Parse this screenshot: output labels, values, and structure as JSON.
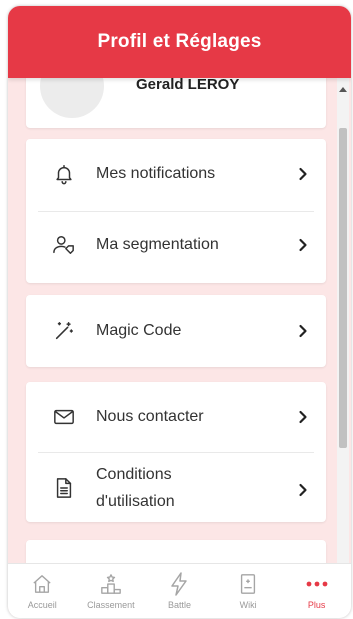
{
  "header": {
    "title": "Profil et Réglages"
  },
  "profile": {
    "name": "Gerald LEROY"
  },
  "menu": {
    "group1": [
      {
        "label": "Mes notifications",
        "icon": "bell-icon"
      },
      {
        "label": "Ma segmentation",
        "icon": "user-tag-icon"
      }
    ],
    "group2": [
      {
        "label": "Magic Code",
        "icon": "magic-wand-icon"
      }
    ],
    "group3": [
      {
        "label": "Nous contacter",
        "icon": "envelope-icon"
      },
      {
        "label_line1": "Conditions",
        "label_line2": "d'utilisation",
        "icon": "document-icon"
      }
    ]
  },
  "tabbar": {
    "items": [
      {
        "label": "Accueil",
        "icon": "home-icon"
      },
      {
        "label": "Classement",
        "icon": "podium-icon"
      },
      {
        "label": "Battle",
        "icon": "lightning-icon"
      },
      {
        "label": "Wiki",
        "icon": "book-icon"
      },
      {
        "label": "Plus",
        "icon": "more-dots-icon"
      }
    ]
  },
  "colors": {
    "accent": "#e63946",
    "background": "#fce6e6",
    "card": "#ffffff",
    "inactive_tab": "#9a9a9a"
  }
}
